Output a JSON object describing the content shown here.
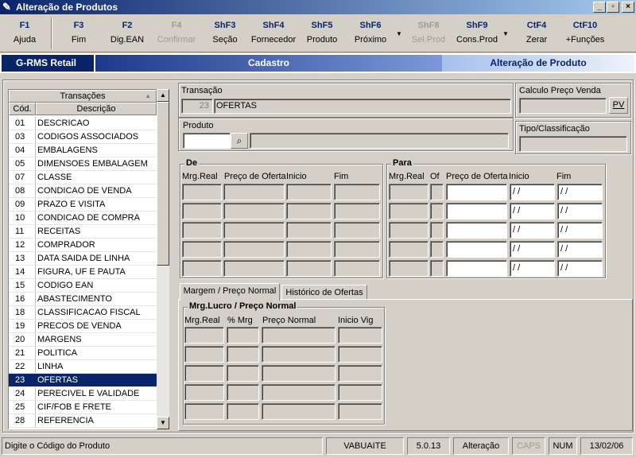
{
  "window": {
    "title": "Alteração de Produtos",
    "minimize": "_",
    "maximize": "▫",
    "close": "×"
  },
  "toolbar": [
    {
      "key": "F1",
      "label": "Ajuda",
      "enabled": true
    },
    {
      "key": "F3",
      "label": "Fim",
      "enabled": true
    },
    {
      "key": "F2",
      "label": "Dig.EAN",
      "enabled": true
    },
    {
      "key": "F4",
      "label": "Confirmar",
      "enabled": false
    },
    {
      "key": "ShF3",
      "label": "Seção",
      "enabled": true
    },
    {
      "key": "ShF4",
      "label": "Fornecedor",
      "enabled": true
    },
    {
      "key": "ShF5",
      "label": "Produto",
      "enabled": true
    },
    {
      "key": "ShF6",
      "label": "Próximo",
      "enabled": true
    },
    {
      "key": "ShF8",
      "label": "Sel.Prod",
      "enabled": false
    },
    {
      "key": "ShF9",
      "label": "Cons.Prod",
      "enabled": true
    },
    {
      "key": "CtF4",
      "label": "Zerar",
      "enabled": true
    },
    {
      "key": "CtF10",
      "label": "+Funções",
      "enabled": true
    }
  ],
  "header": {
    "brand": "G-RMS Retail",
    "module": "Cadastro",
    "screen": "Alteração de Produto"
  },
  "list": {
    "title": "Transações",
    "col_code": "Cód.",
    "col_desc": "Descrição",
    "items": [
      {
        "code": "01",
        "desc": "DESCRICAO"
      },
      {
        "code": "03",
        "desc": "CODIGOS ASSOCIADOS"
      },
      {
        "code": "04",
        "desc": "EMBALAGENS"
      },
      {
        "code": "05",
        "desc": "DIMENSOES EMBALAGEM"
      },
      {
        "code": "07",
        "desc": "CLASSE"
      },
      {
        "code": "08",
        "desc": "CONDICAO DE VENDA"
      },
      {
        "code": "09",
        "desc": "PRAZO E VISITA"
      },
      {
        "code": "10",
        "desc": "CONDICAO DE COMPRA"
      },
      {
        "code": "11",
        "desc": "RECEITAS"
      },
      {
        "code": "12",
        "desc": "COMPRADOR"
      },
      {
        "code": "13",
        "desc": "DATA SAIDA DE LINHA"
      },
      {
        "code": "14",
        "desc": "FIGURA, UF E PAUTA"
      },
      {
        "code": "15",
        "desc": "CODIGO EAN"
      },
      {
        "code": "16",
        "desc": "ABASTECIMENTO"
      },
      {
        "code": "18",
        "desc": "CLASSIFICACAO FISCAL"
      },
      {
        "code": "19",
        "desc": "PRECOS DE VENDA"
      },
      {
        "code": "20",
        "desc": "MARGENS"
      },
      {
        "code": "21",
        "desc": "POLITICA"
      },
      {
        "code": "22",
        "desc": "LINHA"
      },
      {
        "code": "23",
        "desc": "OFERTAS"
      },
      {
        "code": "24",
        "desc": "PERECIVEL E VALIDADE"
      },
      {
        "code": "25",
        "desc": "CIF/FOB E FRETE"
      },
      {
        "code": "28",
        "desc": "REFERENCIA"
      }
    ],
    "selected_code": "23"
  },
  "transacao": {
    "label": "Transação",
    "code": "23",
    "desc": "OFERTAS"
  },
  "produto": {
    "label": "Produto",
    "code": "",
    "desc": ""
  },
  "calculo": {
    "label": "Calculo Preço Venda",
    "value": "",
    "button": "PV"
  },
  "tipo": {
    "label": "Tipo/Classificação",
    "value": ""
  },
  "de": {
    "title": "De",
    "cols": [
      "Mrg.Real",
      "Preço de Oferta",
      "Inicio",
      "Fim"
    ]
  },
  "para": {
    "title": "Para",
    "cols": [
      "Mrg.Real",
      "Of",
      "Preço de Oferta",
      "Inicio",
      "Fim"
    ],
    "date_placeholder": " / /"
  },
  "tabs": [
    {
      "label": "Margem / Preço Normal",
      "active": true
    },
    {
      "label": "Histórico de Ofertas",
      "active": false
    }
  ],
  "margem": {
    "title": "Mrg.Lucro / Preço Normal",
    "cols": [
      "Mrg.Real",
      "% Mrg",
      "Preço Normal",
      "Inicio Vig"
    ]
  },
  "status": {
    "message": "Digite o Código do Produto",
    "user": "VABUAITE",
    "version": "5.0.13",
    "mode": "Alteração",
    "caps": "CAPS",
    "num": "NUM",
    "date": "13/02/06"
  }
}
